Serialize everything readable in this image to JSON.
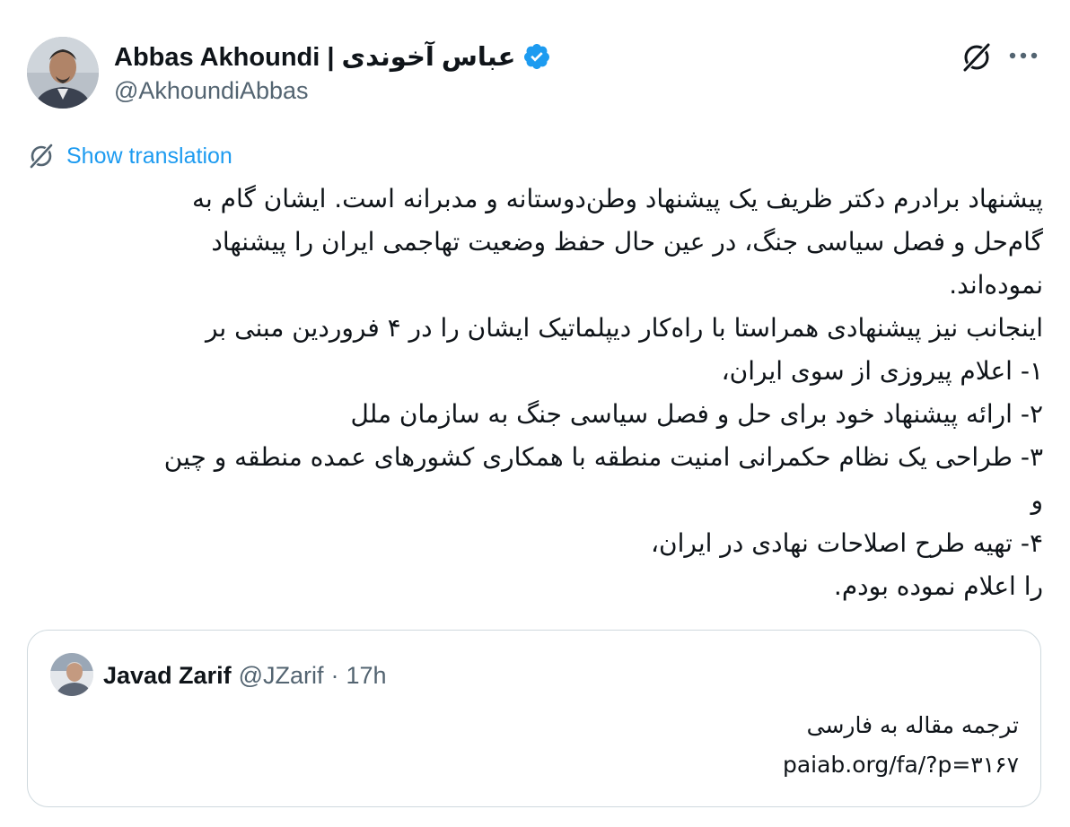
{
  "author": {
    "display_name": "Abbas Akhoundi | عباس آخوندی",
    "handle": "@AkhoundiAbbas",
    "verified": true,
    "avatar_icon": "person-photo"
  },
  "actions": {
    "grok_icon": "grok-icon",
    "more_icon": "more-horizontal-icon"
  },
  "translation": {
    "label": "Show translation",
    "icon": "translate-icon"
  },
  "tweet": {
    "lines": [
      "پیشنهاد برادرم دکتر ظریف یک پیشنهاد وطن‌دوستانه و مدبرانه است. ایشان گام به",
      "گام‌حل و فصل سیاسی جنگ، در عین حال حفظ وضعیت تهاجمی ایران را پیشنهاد",
      "نموده‌اند.",
      "اینجانب نیز پیشنهادی همراستا با راه‌کار دیپلماتیک ایشان را در ۴ فروردین مبنی بر",
      "۱- اعلام پیروزی از سوی ایران،",
      "۲- ارائه پیشنهاد خود برای حل و فصل سیاسی جنگ به سازمان ملل",
      "۳- طراحی یک نظام حکمرانی امنیت منطقه با همکاری کشورهای عمده منطقه و چین",
      "و",
      "۴- تهیه طرح اصلاحات نهادی در ایران،",
      "را اعلام نموده بودم."
    ]
  },
  "quoted_tweet": {
    "name": "Javad Zarif",
    "handle": "@JZarif",
    "separator": "·",
    "time": "17h",
    "lines": [
      "ترجمه مقاله به فارسی",
      "paiab.org/fa/?p=۳۱۶۷"
    ]
  },
  "colors": {
    "accent": "#1d9bf0",
    "text": "#0f1419",
    "muted": "#536471",
    "border": "#cfd9de"
  }
}
